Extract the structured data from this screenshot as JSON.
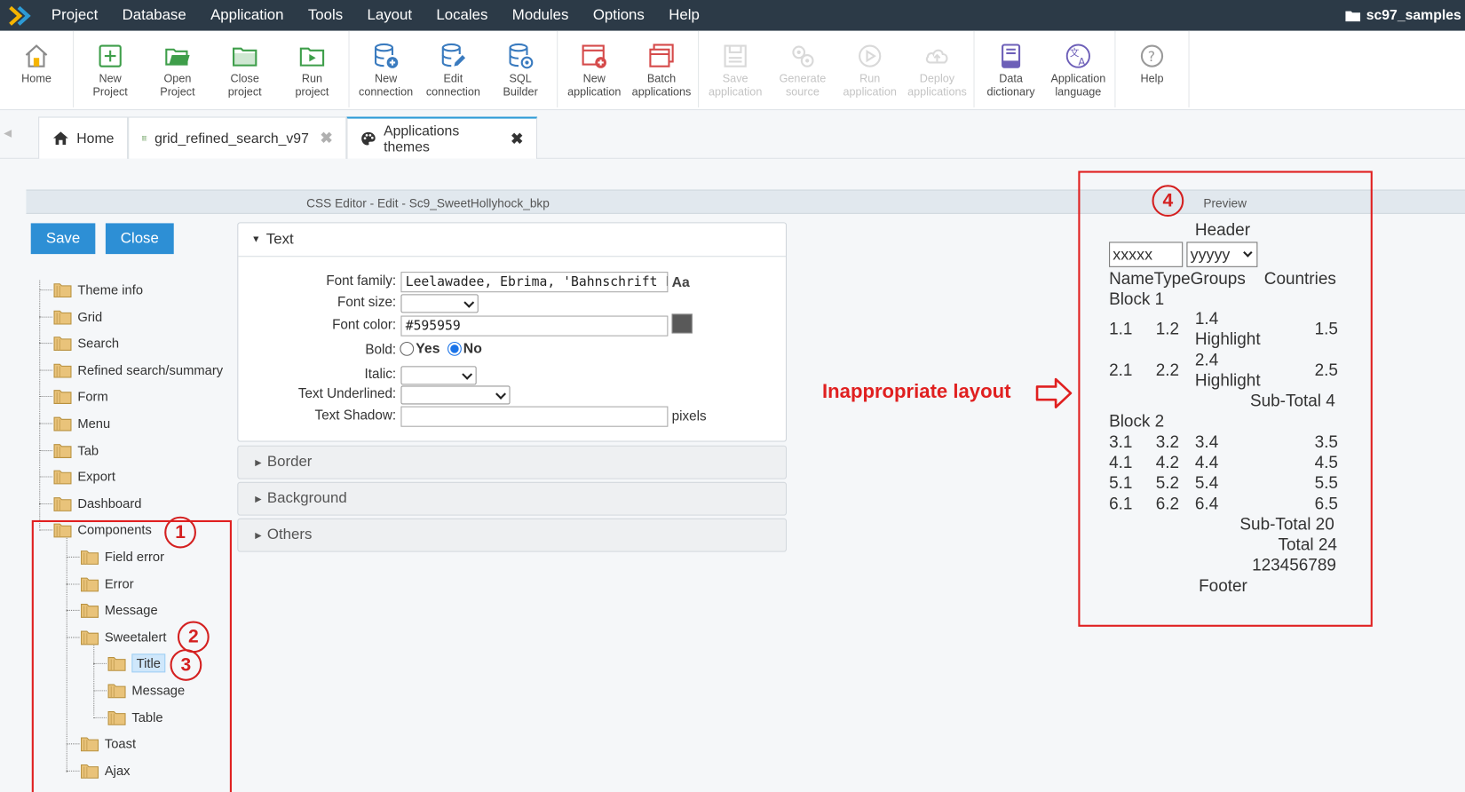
{
  "menubar": {
    "items": [
      "Project",
      "Database",
      "Application",
      "Tools",
      "Layout",
      "Locales",
      "Modules",
      "Options",
      "Help"
    ],
    "project_name": "sc97_samples"
  },
  "toolbar": {
    "groups": [
      [
        {
          "label": "Home",
          "icon": "home-icon"
        }
      ],
      [
        {
          "label": "New\nProject",
          "icon": "new-project-icon"
        },
        {
          "label": "Open\nProject",
          "icon": "open-project-icon"
        },
        {
          "label": "Close\nproject",
          "icon": "close-project-icon"
        },
        {
          "label": "Run\nproject",
          "icon": "run-project-icon"
        }
      ],
      [
        {
          "label": "New\nconnection",
          "icon": "new-connection-icon"
        },
        {
          "label": "Edit\nconnection",
          "icon": "edit-connection-icon"
        },
        {
          "label": "SQL\nBuilder",
          "icon": "sql-builder-icon"
        }
      ],
      [
        {
          "label": "New\napplication",
          "icon": "new-application-icon"
        },
        {
          "label": "Batch\napplications",
          "icon": "batch-applications-icon"
        }
      ],
      [
        {
          "label": "Save\napplication",
          "icon": "save-application-icon",
          "disabled": true
        },
        {
          "label": "Generate\nsource",
          "icon": "generate-source-icon",
          "disabled": true
        },
        {
          "label": "Run\napplication",
          "icon": "run-application-icon",
          "disabled": true
        },
        {
          "label": "Deploy\napplications",
          "icon": "deploy-applications-icon",
          "disabled": true
        }
      ],
      [
        {
          "label": "Data\ndictionary",
          "icon": "data-dictionary-icon"
        },
        {
          "label": "Application\nlanguage",
          "icon": "application-language-icon"
        }
      ],
      [
        {
          "label": "Help",
          "icon": "help-icon"
        }
      ]
    ]
  },
  "tabs": [
    {
      "label": "Home",
      "icon": "home-icon"
    },
    {
      "label": "grid_refined_search_v97",
      "icon": "grid-icon"
    },
    {
      "label": "Applications themes",
      "icon": "palette-icon"
    }
  ],
  "editor": {
    "title": "CSS Editor - Edit - Sc9_SweetHollyhock_bkp",
    "preview_title": "Preview",
    "save_label": "Save",
    "close_label": "Close"
  },
  "tree": {
    "nodes": [
      "Theme info",
      "Grid",
      "Search",
      "Refined search/summary",
      "Form",
      "Menu",
      "Tab",
      "Export",
      "Dashboard",
      "Components",
      "Field error",
      "Error",
      "Message",
      "Sweetalert",
      "Title",
      "Message",
      "Table",
      "Toast",
      "Ajax"
    ]
  },
  "text_panel": {
    "title": "Text",
    "font_family_label": "Font family:",
    "font_family_value": "Leelawadee, Ebrima, 'Bahnschrift Light'",
    "aa_label": "Aa",
    "font_size_label": "Font size:",
    "font_color_label": "Font color:",
    "font_color_value": "#595959",
    "swatch_color": "#595959",
    "bold_label": "Bold:",
    "bold_yes": "Yes",
    "bold_no": "No",
    "italic_label": "Italic:",
    "underlined_label": "Text Underlined:",
    "shadow_label": "Text Shadow:",
    "pixels_label": "pixels"
  },
  "accordions": [
    "Border",
    "Background",
    "Others"
  ],
  "preview": {
    "header": "Header",
    "input1": "xxxxx",
    "select1": "yyyyy",
    "columns": "NameTypeGroups",
    "countries": "Countries",
    "block1": "Block 1",
    "r1": [
      "1.1",
      "1.2",
      "1.4",
      "Highlight",
      "1.5"
    ],
    "r2": [
      "2.1",
      "2.2",
      "2.4",
      "Highlight",
      "2.5"
    ],
    "subtotal1": "Sub-Total 4",
    "block2": "Block 2",
    "rows2": [
      [
        "3.1",
        "3.2",
        "3.4",
        "3.5"
      ],
      [
        "4.1",
        "4.2",
        "4.4",
        "4.5"
      ],
      [
        "5.1",
        "5.2",
        "5.4",
        "5.5"
      ],
      [
        "6.1",
        "6.2",
        "6.4",
        "6.5"
      ]
    ],
    "subtotal2": "Sub-Total 20",
    "total": "Total 24",
    "number": "123456789",
    "footer": "Footer"
  },
  "annotations": {
    "markers": [
      "1",
      "2",
      "3",
      "4"
    ],
    "layout_note": "Inappropriate layout",
    "color": "#e02020"
  }
}
